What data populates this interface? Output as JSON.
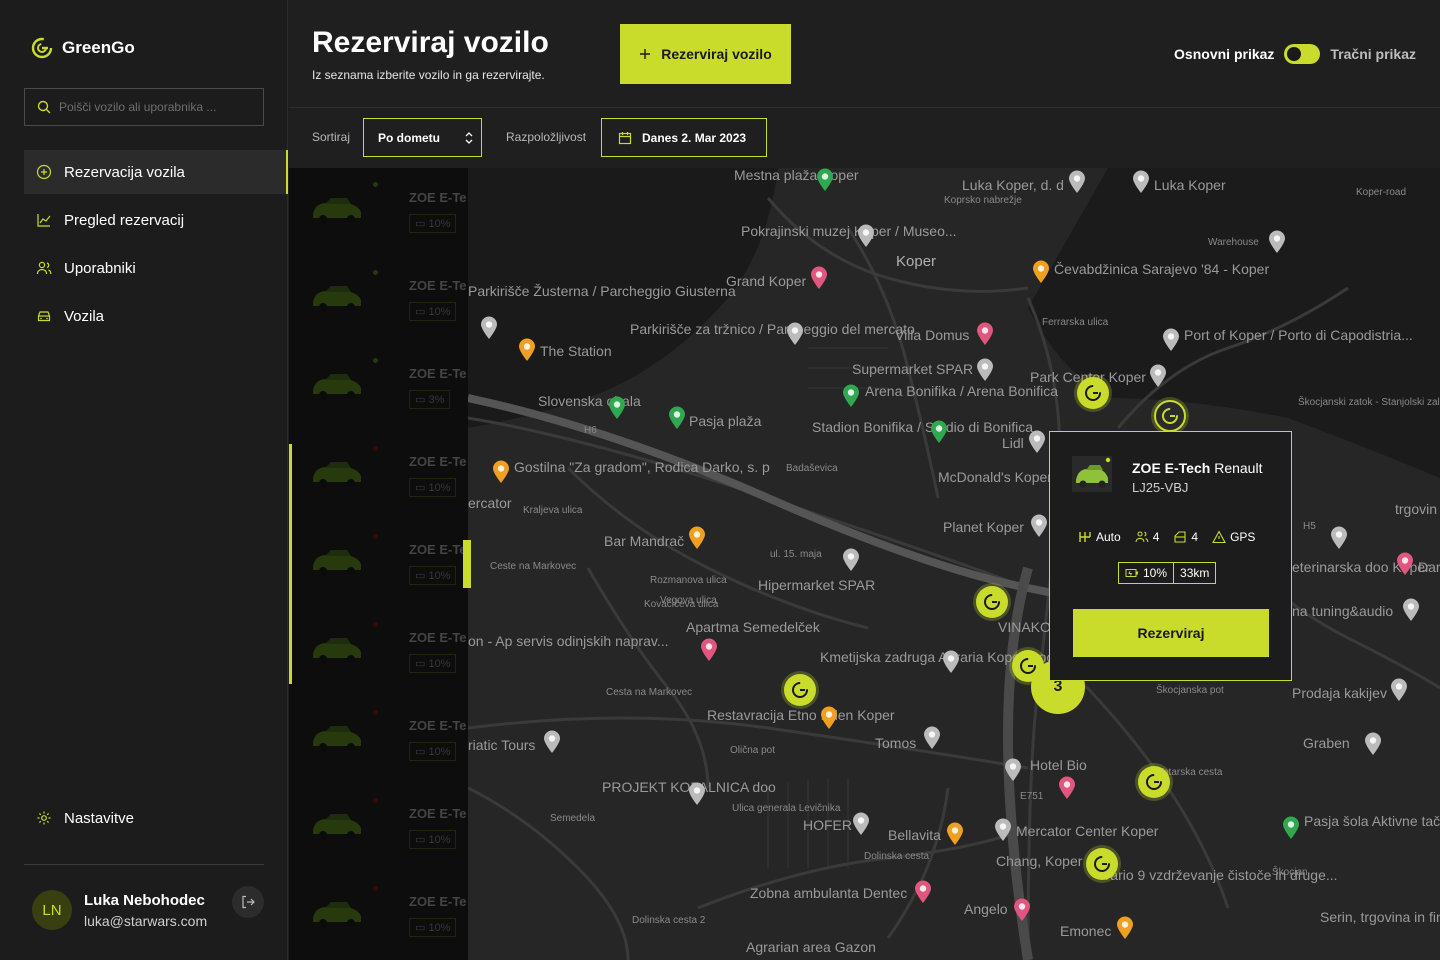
{
  "app": {
    "name": "GreenGo"
  },
  "sidebar": {
    "search_placeholder": "Poišči vozilo ali uporabnika ...",
    "items": [
      {
        "label": "Rezervacija vozila",
        "icon": "plus-circle-icon",
        "active": true
      },
      {
        "label": "Pregled rezervacij",
        "icon": "chart-icon",
        "active": false
      },
      {
        "label": "Uporabniki",
        "icon": "users-icon",
        "active": false
      },
      {
        "label": "Vozila",
        "icon": "car-icon",
        "active": false
      }
    ],
    "settings_label": "Nastavitve",
    "user": {
      "initials": "LN",
      "name": "Luka Nebohodec",
      "email": "luka@starwars.com"
    }
  },
  "header": {
    "title": "Rezerviraj vozilo",
    "subtitle": "Iz seznama izberite vozilo in ga rezervirajte.",
    "cta_label": "Rezerviraj vozilo",
    "view_basic": "Osnovni prikaz",
    "view_strip": "Tračni prikaz"
  },
  "filters": {
    "sort_label": "Sortiraj",
    "sort_value": "Po dometu",
    "availability_label": "Razpoložljivost",
    "date_value": "Danes 2. Mar 2023"
  },
  "list": {
    "rows": [
      {
        "name": "ZOE E-Te",
        "battery": "10%",
        "dot": "#3a5a10"
      },
      {
        "name": "ZOE E-Te",
        "battery": "10%",
        "dot": "#3a5a10"
      },
      {
        "name": "ZOE E-Te",
        "battery": "3%",
        "dot": "#3a5a10"
      },
      {
        "name": "ZOE E-Te",
        "battery": "10%",
        "dot": "#5a1010"
      },
      {
        "name": "ZOE E-Te",
        "battery": "10%",
        "dot": "#5a1010"
      },
      {
        "name": "ZOE E-Te",
        "battery": "10%",
        "dot": "#5a1010"
      },
      {
        "name": "ZOE E-Te",
        "battery": "10%",
        "dot": "#5a1010"
      },
      {
        "name": "ZOE E-Te",
        "battery": "10%",
        "dot": "#5a1010"
      },
      {
        "name": "ZOE E-Te",
        "battery": "10%",
        "dot": "#5a1010"
      }
    ]
  },
  "map": {
    "labels": [
      "Mestna plaža Koper",
      "Luka Koper, d. d",
      "Luka Koper",
      "Koprsko nabrežje",
      "Pokrajinski muzej Koper / Museo...",
      "Koper",
      "Warehouse",
      "Grand Koper",
      "Čevabdžinica Sarajevo '84 - Koper",
      "Parkirišče Žusterna / Parcheggio Giusterna",
      "Parkirišče za tržnico / Parcheggio del mercato",
      "Villa Domus",
      "Port of Koper / Porto di Capodistria...",
      "The Station",
      "Supermarket SPAR",
      "Arena Bonifika / Arena Bonifica",
      "Park Center Koper",
      "Slovenska obala",
      "Pasja plaža",
      "Stadion Bonifika / Stadio di Bonifica",
      "Lidl",
      "Gostilna \"Za gradom\", Rodica Darko, s. p",
      "McDonald's Koper",
      "Bar Mandrač",
      "Planet Koper",
      "Hipermarket SPAR",
      "Apartma Semedelček",
      "Kmetijska zadruga Agraria Koper, zoo...",
      "VINAKO boutique",
      "Restavracija Etno Eden Koper",
      "riatic Tours",
      "Tomos",
      "Hotel Bio",
      "PROJEKT KOPALNICA doo",
      "HOFER",
      "Bellavita",
      "Mercator Center Koper",
      "Chang, Koper",
      "Vario 9 vzdrževanje čistoče in druge...",
      "Zobna ambulanta Dentec",
      "Angelo",
      "Emonec",
      "Agrarian area Gazon",
      "Prodaja kakijev",
      "Graben",
      "Pasja šola Aktivne tačke - poligon",
      "Serin, trgovina in finančni inženiring",
      "eterinarska doo Koper",
      "na tuning&audio",
      "trgovin",
      "Dar",
      "ercator",
      "on - Ap servis odinjskih naprav...",
      "Ceste na Markovec",
      "Cesta na Markovec",
      "Dolinska cesta",
      "Škocjanski zatok - Stanjolski zaliv",
      "Škocjan",
      "H6",
      "H5",
      "E751",
      "Badaševica",
      "Kraljeva ulica",
      "Olična pot",
      "Ulica generala Levičnika",
      "Semedela",
      "ul. 15. maja",
      "Rozmanova ulica",
      "Vegova ulica",
      "Kovačičeva ulica",
      "Ferrarska ulica",
      "Koper-road",
      "Dolinska cesta 2",
      "Škocjanska pot",
      "Tatarska cesta"
    ],
    "cluster_count": "3"
  },
  "popup": {
    "brand": "ZOE E-Tech",
    "model": "Renault",
    "plate": "LJ25-VBJ",
    "transmission": "Auto",
    "seats": "4",
    "doors": "4",
    "gps": "GPS",
    "battery": "10%",
    "range": "33km",
    "button": "Rezerviraj"
  },
  "colors": {
    "accent": "#c9dc2c",
    "bg": "#1f1f1f",
    "map": "#262626"
  }
}
